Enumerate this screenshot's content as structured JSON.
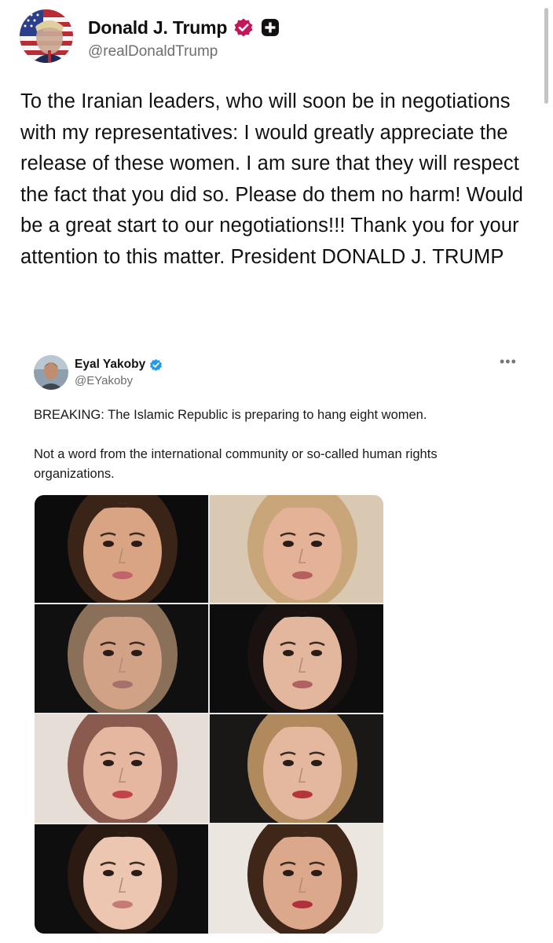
{
  "post": {
    "author": {
      "display_name": "Donald J. Trump",
      "handle": "@realDonaldTrump",
      "avatar_icon": "avatar-american-flag-portrait",
      "verified_icon": "verified-badge-icon",
      "affiliation_icon": "plus-badge-icon"
    },
    "text": "To the Iranian leaders, who will soon be in negotiations with my representatives: I would greatly appreciate the release of these women. I am sure that they will respect the fact that you did so. Please do them no harm! Would be a great start to our negotiations!!! Thank you for your attention to this matter. President DONALD J. TRUMP"
  },
  "embedded_post": {
    "author": {
      "display_name": "Eyal Yakoby",
      "handle": "@EYakoby",
      "verified_icon": "blue-verified-badge-icon"
    },
    "more_icon": "more-options-icon",
    "more_glyph": "•••",
    "paragraph_1": "BREAKING: The Islamic Republic is preparing to hang eight women.",
    "paragraph_2": "Not a word from the international community or so-called human rights organizations.",
    "photos": [
      {
        "id": "portrait-1",
        "background": "#0c0c0c",
        "skin": "#d8a484",
        "hair": "#3a2418",
        "lips": "#c0646a"
      },
      {
        "id": "portrait-2",
        "background": "#d9c8b2",
        "skin": "#e4b296",
        "hair": "#c9a57a",
        "lips": "#b5605e"
      },
      {
        "id": "portrait-3",
        "background": "#101010",
        "skin": "#d2a286",
        "hair": "#8a7058",
        "lips": "#a6716a"
      },
      {
        "id": "portrait-4",
        "background": "#0d0d0d",
        "skin": "#e2b79e",
        "hair": "#1a1210",
        "lips": "#b06262"
      },
      {
        "id": "portrait-5",
        "background": "#e6ddd6",
        "skin": "#e5b7a1",
        "hair": "#8a5a4e",
        "lips": "#c0444a"
      },
      {
        "id": "portrait-6",
        "background": "#1a1816",
        "skin": "#e4b89e",
        "hair": "#b08a5c",
        "lips": "#b2363a"
      },
      {
        "id": "portrait-7",
        "background": "#0e0e0e",
        "skin": "#ecc6b0",
        "hair": "#2a1a12",
        "lips": "#c67a76"
      },
      {
        "id": "portrait-8",
        "background": "#ece6e0",
        "skin": "#dca88c",
        "hair": "#3e2618",
        "lips": "#b2303a"
      }
    ]
  },
  "colors": {
    "verified_badge": "#c2185b",
    "embedded_verified_badge": "#1d9bf0",
    "text": "#111111",
    "secondary_text": "#6f6f6f"
  }
}
